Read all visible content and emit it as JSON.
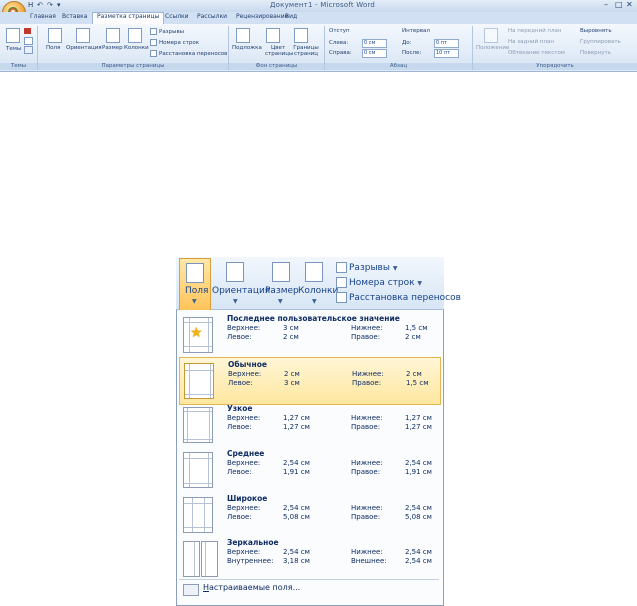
{
  "window": {
    "title": "Документ1 - Microsoft Word",
    "controls": [
      "–",
      "□",
      "✕"
    ]
  },
  "qat": [
    "H",
    "↶",
    "↷",
    "▾"
  ],
  "tabs": [
    "Главная",
    "Вставка",
    "Разметка страницы",
    "Ссылки",
    "Рассылки",
    "Рецензирование",
    "Вид"
  ],
  "ribbon": {
    "themes_label": "Темы",
    "fields_label": "Поля",
    "orientation_label": "Ориентация",
    "size_label": "Размер",
    "columns_label": "Колонки",
    "breaks_label": "Разрывы",
    "line_numbers_label": "Номера строк",
    "hyphenation_label": "Расстановка переносов",
    "watermark_label": "Подложка",
    "page_color_label": "Цвет страницы",
    "page_borders_label": "Границы страниц",
    "indent_header": "Отступ",
    "indent_left_label": "Слева:",
    "indent_left_value": "0 см",
    "indent_right_label": "Справа:",
    "indent_right_value": "0 см",
    "spacing_header": "Интервал",
    "spacing_before_label": "До:",
    "spacing_before_value": "0 пт",
    "spacing_after_label": "После:",
    "spacing_after_value": "10 пт",
    "position_label": "Положение",
    "front_label": "На передний план",
    "back_label": "На задний план",
    "wrap_label": "Обтекание текстом",
    "align_label": "Выровнять",
    "group_label": "Группировать",
    "rotate_label": "Повернуть",
    "groups": [
      "Темы",
      "Параметры страницы",
      "Фон страницы",
      "Абзац",
      "Упорядочить"
    ]
  },
  "zoom": {
    "fields_label": "Поля",
    "orientation_label": "Ориентация",
    "size_label": "Размер",
    "columns_label": "Колонки",
    "breaks_label": "Разрывы",
    "line_numbers_label": "Номера строк",
    "hyphenation_label": "Расстановка переносов"
  },
  "margins_menu": {
    "items": [
      {
        "title": "Последнее пользовательское значение",
        "r1": [
          "Верхнее:",
          "3 см",
          "Нижнее:",
          "1,5 см"
        ],
        "r2": [
          "Левое:",
          "2 см",
          "Правое:",
          "2 см"
        ],
        "highlighted": false
      },
      {
        "title": "Обычное",
        "r1": [
          "Верхнее:",
          "2 см",
          "Нижнее:",
          "2 см"
        ],
        "r2": [
          "Левое:",
          "3 см",
          "Правое:",
          "1,5 см"
        ],
        "highlighted": true
      },
      {
        "title": "Узкое",
        "r1": [
          "Верхнее:",
          "1,27 см",
          "Нижнее:",
          "1,27 см"
        ],
        "r2": [
          "Левое:",
          "1,27 см",
          "Правое:",
          "1,27 см"
        ],
        "highlighted": false
      },
      {
        "title": "Среднее",
        "r1": [
          "Верхнее:",
          "2,54 см",
          "Нижнее:",
          "2,54 см"
        ],
        "r2": [
          "Левое:",
          "1,91 см",
          "Правое:",
          "1,91 см"
        ],
        "highlighted": false
      },
      {
        "title": "Широкое",
        "r1": [
          "Верхнее:",
          "2,54 см",
          "Нижнее:",
          "2,54 см"
        ],
        "r2": [
          "Левое:",
          "5,08 см",
          "Правое:",
          "5,08 см"
        ],
        "highlighted": false
      },
      {
        "title": "Зеркальное",
        "r1": [
          "Верхнее:",
          "2,54 см",
          "Нижнее:",
          "2,54 см"
        ],
        "r2": [
          "Внутреннее:",
          "3,18 см",
          "Внешнее:",
          "2,54 см"
        ],
        "highlighted": false
      }
    ],
    "custom_label_hotkey": "Н",
    "custom_label_rest": "астраиваемые поля..."
  }
}
